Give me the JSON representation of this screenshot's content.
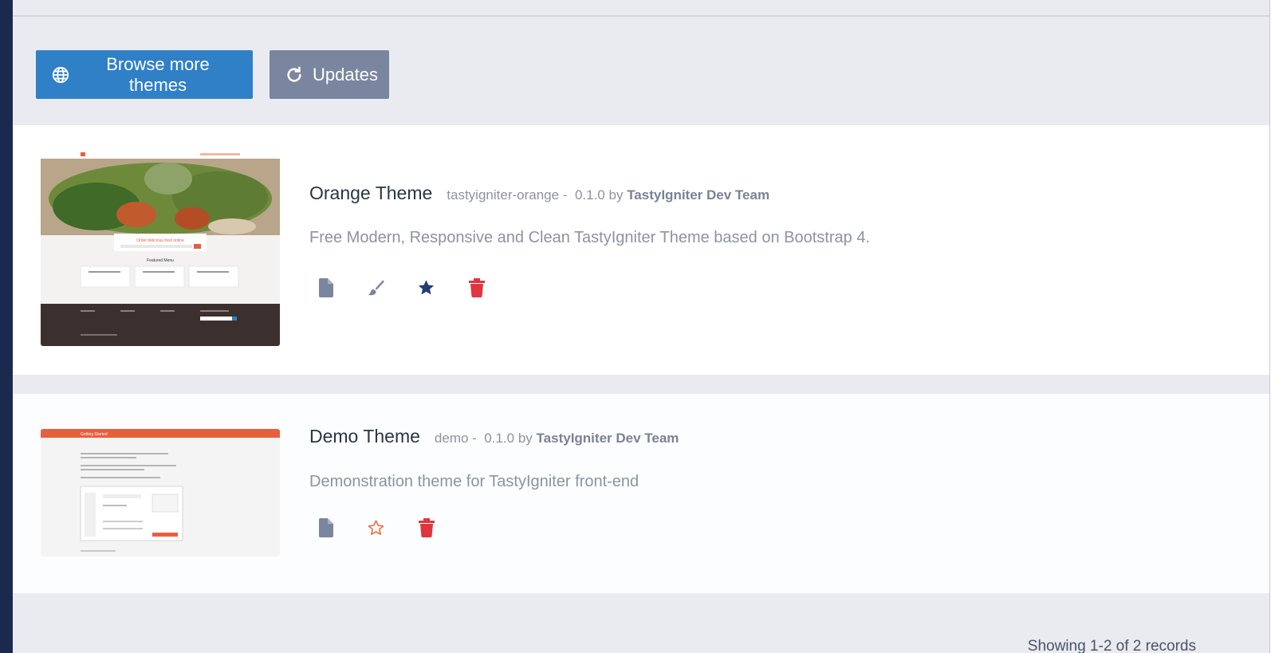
{
  "toolbar": {
    "browse_label": "Browse more themes",
    "updates_label": "Updates"
  },
  "themes": [
    {
      "name": "Orange Theme",
      "code": "tastyigniter-orange",
      "version": "0.1.0",
      "by": "by",
      "author": "TastyIgniter Dev Team",
      "description": "Free Modern, Responsive and Clean TastyIgniter Theme based on Bootstrap 4.",
      "preview": {
        "headline": "Order delicious food online",
        "section": "Featured Menu"
      }
    },
    {
      "name": "Demo Theme",
      "code": "demo",
      "version": "0.1.0",
      "by": "by",
      "author": "TastyIgniter Dev Team",
      "description": "Demonstration theme for TastyIgniter front-end",
      "preview": {
        "header": "Getting Started"
      }
    }
  ],
  "footer": {
    "records": "Showing 1-2 of 2 records"
  },
  "colors": {
    "primary": "#2f80c7",
    "secondary": "#7a869f",
    "action_icon": "#7a869f",
    "default_star": "#233d6e",
    "outline_star": "#f06a3c",
    "delete": "#e0353f",
    "theme_accent": "#e8603b"
  }
}
